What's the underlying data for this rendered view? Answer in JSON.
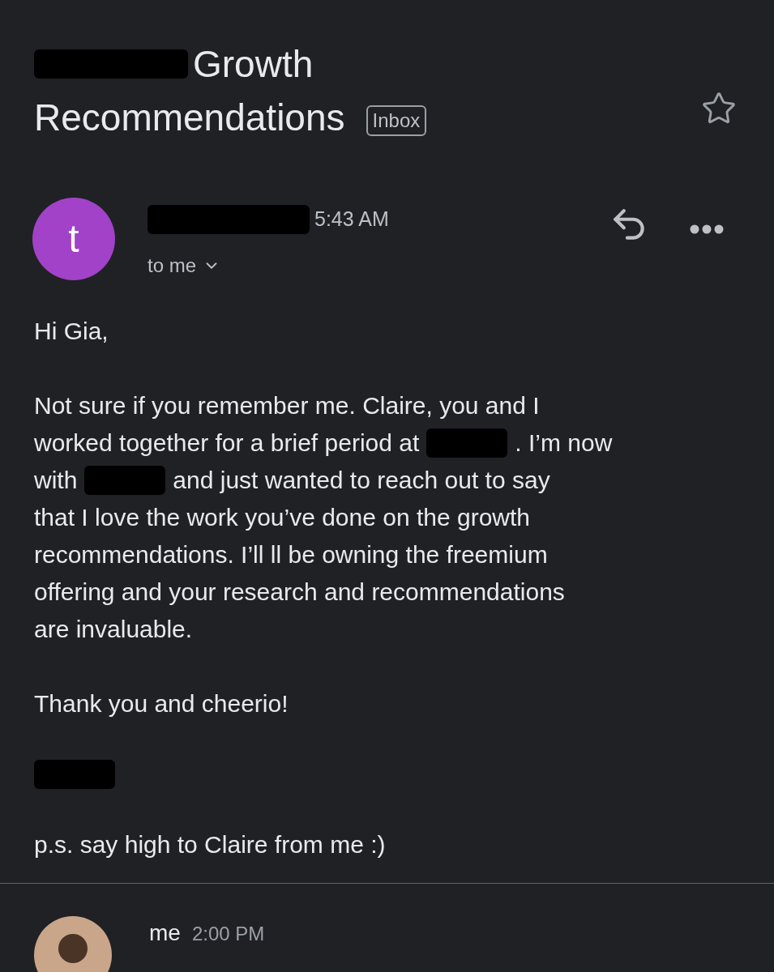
{
  "subject": {
    "lines": [
      {
        "redacted": true,
        "text": "Growth"
      },
      {
        "redacted": false,
        "text": "Recommendations"
      }
    ],
    "label": "Inbox",
    "starred": false
  },
  "message": {
    "avatar_letter": "t",
    "sender_redacted": true,
    "time": "5:43 AM",
    "recipient": "to me"
  },
  "body": [
    {
      "parts": [
        {
          "kind": "text",
          "text": "Hi Gia,"
        }
      ]
    },
    {
      "lines": [
        [
          {
            "kind": "text",
            "text": "Not sure if you remember me. Claire, you and I"
          }
        ],
        [
          {
            "kind": "text",
            "text": "worked together for a brief period at"
          },
          {
            "kind": "redaction"
          },
          {
            "kind": "text",
            "text": ". I’m now"
          }
        ],
        [
          {
            "kind": "text",
            "text": "with"
          },
          {
            "kind": "redaction"
          },
          {
            "kind": "text",
            "text": "and just wanted to reach out to say"
          }
        ],
        [
          {
            "kind": "text",
            "text": "that I love the work you’ve done on the growth"
          }
        ],
        [
          {
            "kind": "text",
            "text": "recommendations. I’ll ll be owning the freemium"
          }
        ],
        [
          {
            "kind": "text",
            "text": "offering and your research and recommendations"
          }
        ],
        [
          {
            "kind": "text",
            "text": "are invaluable."
          }
        ]
      ]
    },
    {
      "parts": [
        {
          "kind": "text",
          "text": "Thank you and cheerio!"
        }
      ]
    },
    {
      "parts": [
        {
          "kind": "redaction"
        }
      ]
    },
    {
      "parts": [
        {
          "kind": "text",
          "text": "p.s. say high to Claire from me :)"
        }
      ]
    }
  ],
  "reply": {
    "sender": "me",
    "time": "2:00 PM"
  }
}
